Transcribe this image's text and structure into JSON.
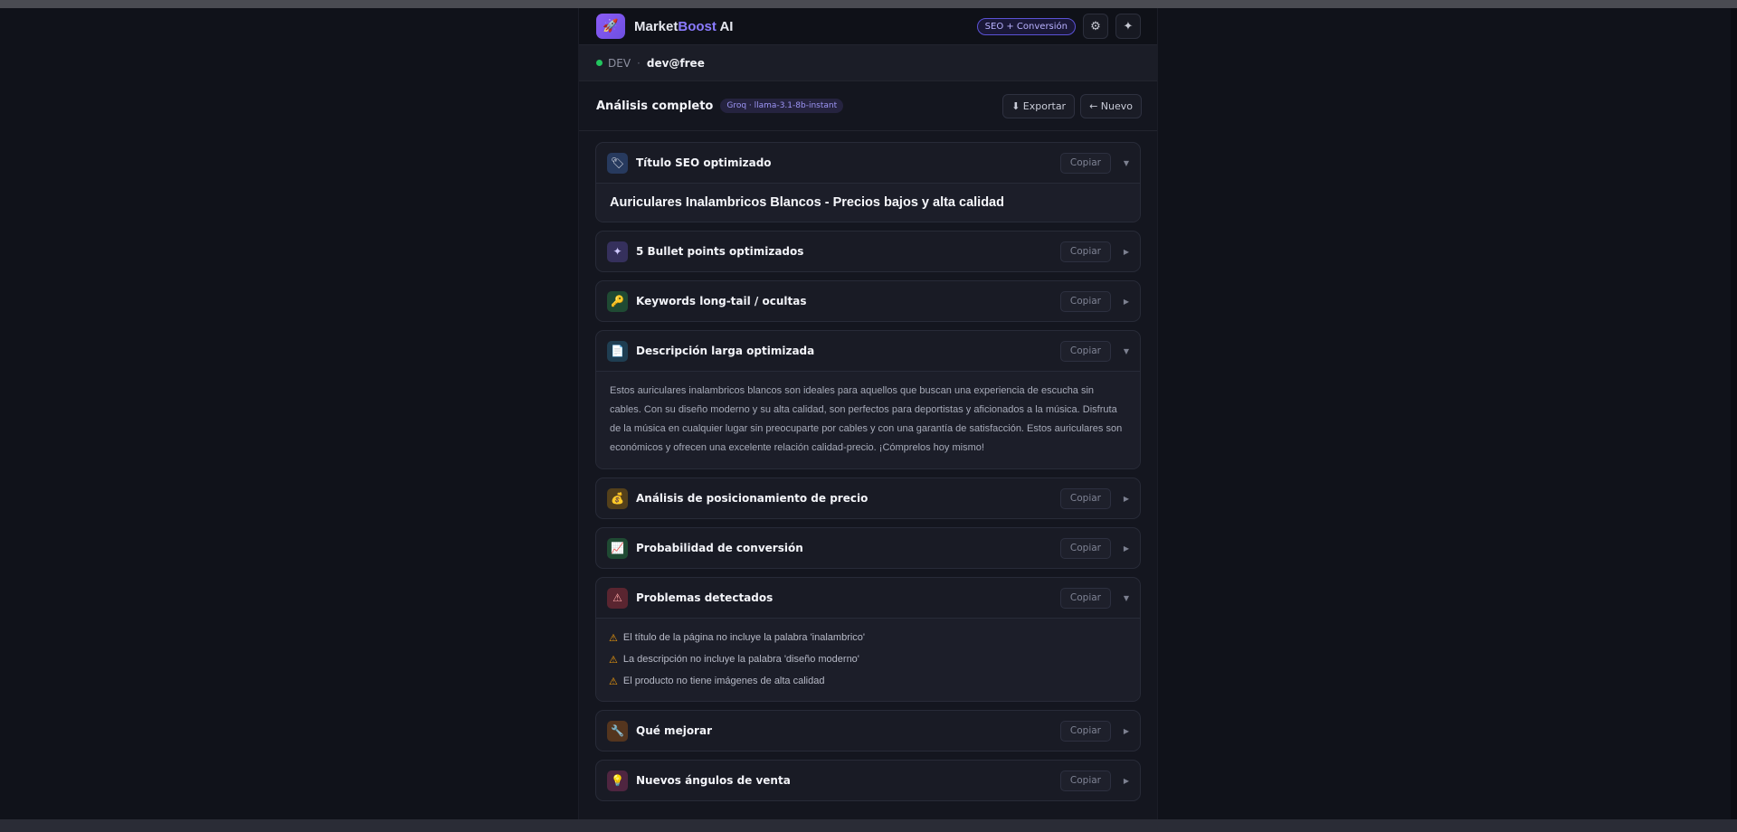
{
  "header": {
    "brand_main": "Market",
    "brand_accent": "Boost",
    "brand_suffix": " AI",
    "badge": "SEO + Conversión",
    "logo_icon": "rocket-icon",
    "buttons": [
      "settings-icon",
      "sparkle-icon"
    ]
  },
  "userbar": {
    "env": "DEV",
    "separator": "·",
    "user": "dev@free",
    "status_color": "#22c55e"
  },
  "toolbar": {
    "title": "Análisis completo",
    "model": "Groq · llama-3.1-8b-instant",
    "export_label": "⬇ Exportar",
    "new_label": "← Nuevo"
  },
  "copy_label": "Copiar",
  "cards": [
    {
      "title": "Título SEO optimizado",
      "icon": "tag-icon",
      "glyph": "🏷",
      "icon_bg": "#273a5e",
      "expanded": true,
      "content": "Auriculares Inalambricos Blancos - Precios bajos y alta calidad"
    },
    {
      "title": "5 Bullet points optimizados",
      "icon": "sparkle-icon",
      "glyph": "✦",
      "icon_bg": "#35305c",
      "expanded": false
    },
    {
      "title": "Keywords long-tail / ocultas",
      "icon": "key-icon",
      "glyph": "🔑",
      "icon_bg": "#1f4a33",
      "expanded": false
    },
    {
      "title": "Descripción larga optimizada",
      "icon": "document-icon",
      "glyph": "📄",
      "icon_bg": "#1f3e52",
      "expanded": true,
      "content": "Estos auriculares inalambricos blancos son ideales para aquellos que buscan una experiencia de escucha sin cables. Con su diseño moderno y su alta calidad, son perfectos para deportistas y aficionados a la música. Disfruta de la música en cualquier lugar sin preocuparte por cables y con una garantía de satisfacción. Estos auriculares son económicos y ofrecen una excelente relación calidad-precio. ¡Cómprelos hoy mismo!"
    },
    {
      "title": "Análisis de posicionamiento de precio",
      "icon": "money-bag-icon",
      "glyph": "💰",
      "icon_bg": "#54401a",
      "expanded": false
    },
    {
      "title": "Probabilidad de conversión",
      "icon": "chart-icon",
      "glyph": "📈",
      "icon_bg": "#1f4a33",
      "expanded": false
    },
    {
      "title": "Problemas detectados",
      "icon": "warning-icon",
      "glyph": "⚠",
      "icon_bg": "#5a2530",
      "expanded": true,
      "items": [
        "El título de la página no incluye la palabra 'inalambrico'",
        "La descripción no incluye la palabra 'diseño moderno'",
        "El producto no tiene imágenes de alta calidad"
      ]
    },
    {
      "title": "Qué mejorar",
      "icon": "wrench-icon",
      "glyph": "🔧",
      "icon_bg": "#54351e",
      "expanded": false
    },
    {
      "title": "Nuevos ángulos de venta",
      "icon": "lightbulb-icon",
      "glyph": "💡",
      "icon_bg": "#4f2540",
      "expanded": false
    }
  ]
}
